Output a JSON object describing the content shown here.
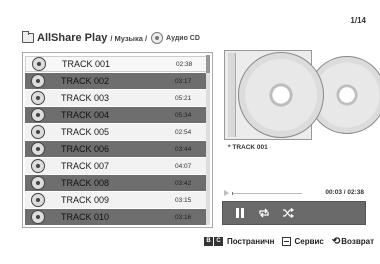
{
  "header": {
    "app_title": "AllShare Play",
    "breadcrumb_music": "/ Музыка /",
    "crumb_cd": "Аудио CD",
    "page_counter": "1/14"
  },
  "tracks": [
    {
      "name": "TRACK 001",
      "time": "02:38"
    },
    {
      "name": "TRACK 002",
      "time": "03:17"
    },
    {
      "name": "TRACK 003",
      "time": "05:21"
    },
    {
      "name": "TRACK 004",
      "time": "05:34"
    },
    {
      "name": "TRACK 005",
      "time": "02:54"
    },
    {
      "name": "TRACK 006",
      "time": "03:44"
    },
    {
      "name": "TRACK 007",
      "time": "04:07"
    },
    {
      "name": "TRACK 008",
      "time": "03:42"
    },
    {
      "name": "TRACK 009",
      "time": "03:15"
    },
    {
      "name": "TRACK 010",
      "time": "03:16"
    }
  ],
  "now_playing": {
    "label": "TRACK 001",
    "elapsed": "00:03 / 02:38",
    "progress_fraction": 0.02
  },
  "footer": {
    "key_b": "B",
    "key_c": "C",
    "page_label": "Постраничн",
    "tools_label": "Сервис",
    "return_label": "Возврат"
  },
  "icons": {
    "folder": "folder-icon",
    "cd": "cd-icon",
    "pause": "pause-icon",
    "repeat": "repeat-icon",
    "shuffle": "shuffle-icon"
  },
  "colors": {
    "row_dark": "#6e6e6e",
    "row_light": "#f2f2f2",
    "control_bar": "#6a6a6a"
  }
}
